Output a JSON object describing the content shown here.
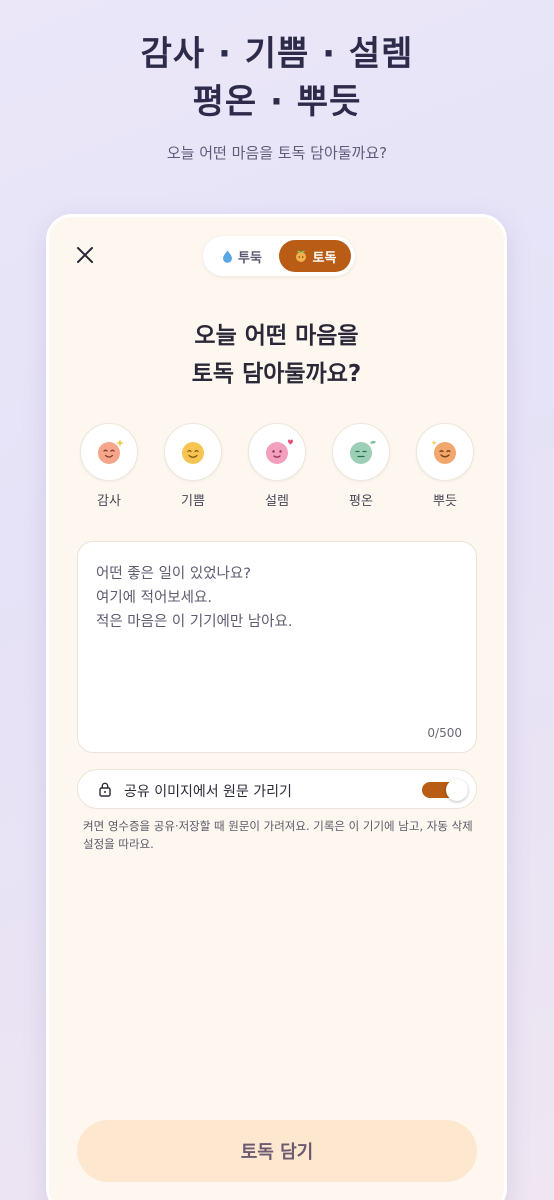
{
  "hero": {
    "title_line1": "감사 · 기쁨 · 설렘",
    "title_line2": "평온 · 뿌듯",
    "subtitle": "오늘 어떤 마음을 토독 담아둘까요?"
  },
  "card": {
    "close_icon": "close-icon",
    "mode_toggle": {
      "options": [
        {
          "label": "투둑",
          "icon": "water-drop-icon"
        },
        {
          "label": "토독",
          "icon": "sprout-icon",
          "selected": true
        }
      ]
    },
    "question_line1": "오늘 어떤 마음을",
    "question_line2": "토독 담아둘까요?",
    "moods": [
      {
        "label": "감사",
        "icon": "grateful-face-icon",
        "color": "#f4a58a"
      },
      {
        "label": "기쁨",
        "icon": "joy-face-icon",
        "color": "#f6c452"
      },
      {
        "label": "설렘",
        "icon": "excited-face-icon",
        "color": "#f3a0bf"
      },
      {
        "label": "평온",
        "icon": "calm-face-icon",
        "color": "#9ccfb6"
      },
      {
        "label": "뿌듯",
        "icon": "proud-face-icon",
        "color": "#f2a76c"
      }
    ],
    "memo": {
      "placeholder": "어떤 좋은 일이 있었나요?\n여기에 적어보세요.\n적은 마음은 이 기기에만 남아요.",
      "value": "",
      "counter": "0/500"
    },
    "share": {
      "label": "공유 이미지에서 원문 가리기",
      "enabled": true,
      "note": "켜면 영수증을 공유·저장할 때 원문이 가려져요. 기록은 이 기기에 남고, 자동 삭제 설정을 따라요."
    },
    "submit_label": "토독 담기"
  },
  "colors": {
    "accent": "#b85c16",
    "button_bg": "#fde8cf",
    "card_bg": "#fdf7ef",
    "title": "#2d2a4a"
  }
}
